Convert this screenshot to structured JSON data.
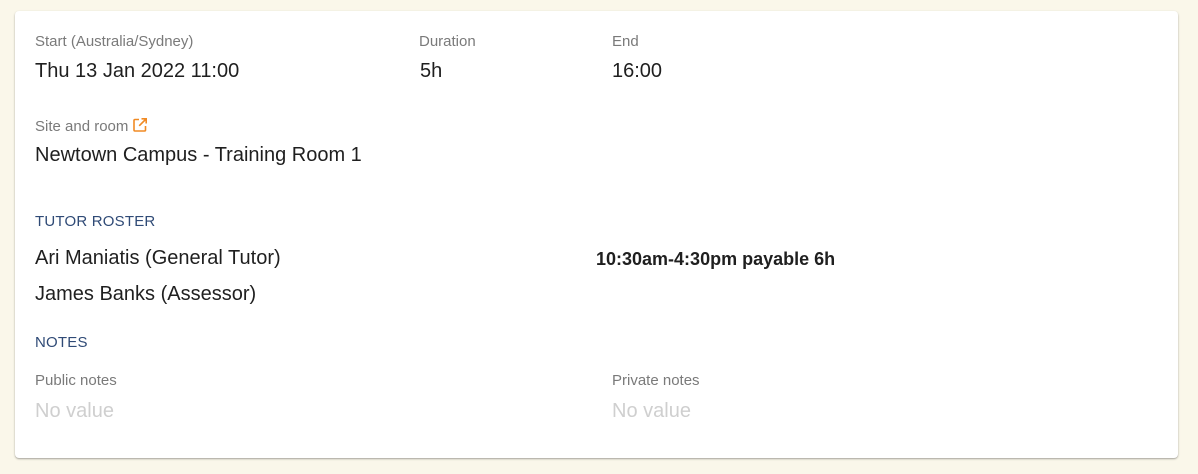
{
  "schedule": {
    "start_label": "Start (Australia/Sydney)",
    "start_value": "Thu 13 Jan 2022 11:00",
    "duration_label": "Duration",
    "duration_value": "5h",
    "end_label": "End",
    "end_value": "16:00"
  },
  "site": {
    "label": "Site and room",
    "value": "Newtown Campus - Training Room 1",
    "link_icon": "external-link-icon",
    "link_icon_color": "#f08a24"
  },
  "tutor_roster": {
    "heading": "TUTOR ROSTER",
    "tutors": [
      {
        "name": "Ari Maniatis (General Tutor)",
        "schedule": "10:30am-4:30pm payable 6h"
      },
      {
        "name": "James Banks (Assessor)",
        "schedule": ""
      }
    ]
  },
  "notes": {
    "heading": "NOTES",
    "public_label": "Public notes",
    "public_value": "No value",
    "private_label": "Private notes",
    "private_value": "No value"
  },
  "colors": {
    "background": "#faf7ea",
    "section_heading": "#2f4a76",
    "accent": "#f08a24"
  }
}
